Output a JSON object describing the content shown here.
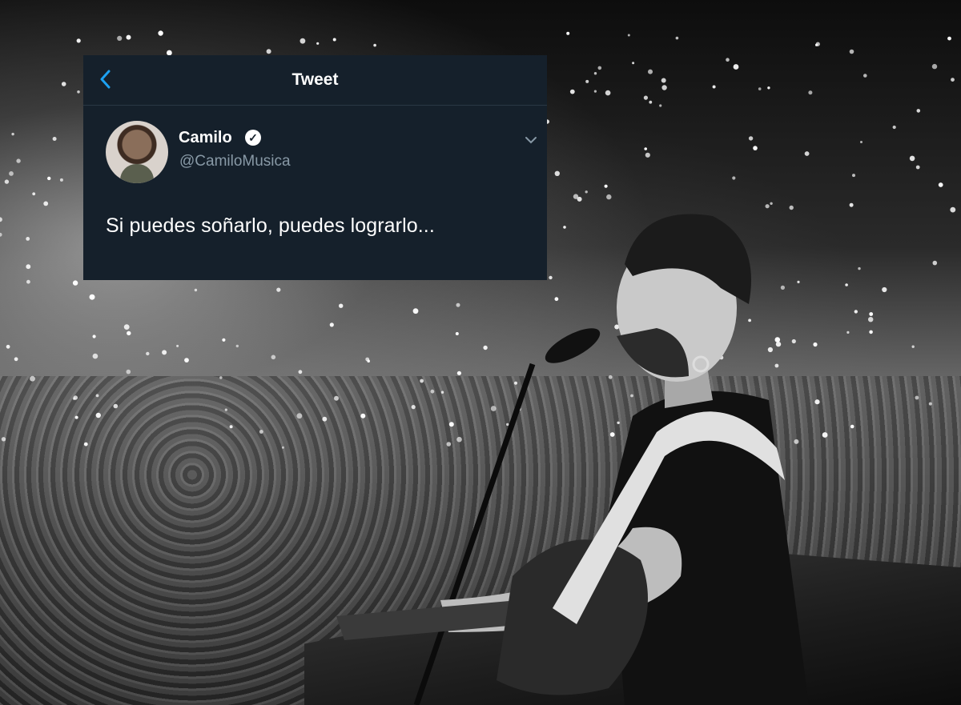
{
  "header": {
    "back_icon": "chevron-left-icon",
    "title": "Tweet"
  },
  "author": {
    "name": "Camilo",
    "handle": "@CamiloMusica",
    "verified_icon": "verified-badge-icon"
  },
  "tweet": {
    "text": "Si puedes soñarlo, puedes lograrlo..."
  },
  "colors": {
    "card_bg": "#15202b",
    "accent": "#1da1f2",
    "muted": "#8899a6"
  }
}
